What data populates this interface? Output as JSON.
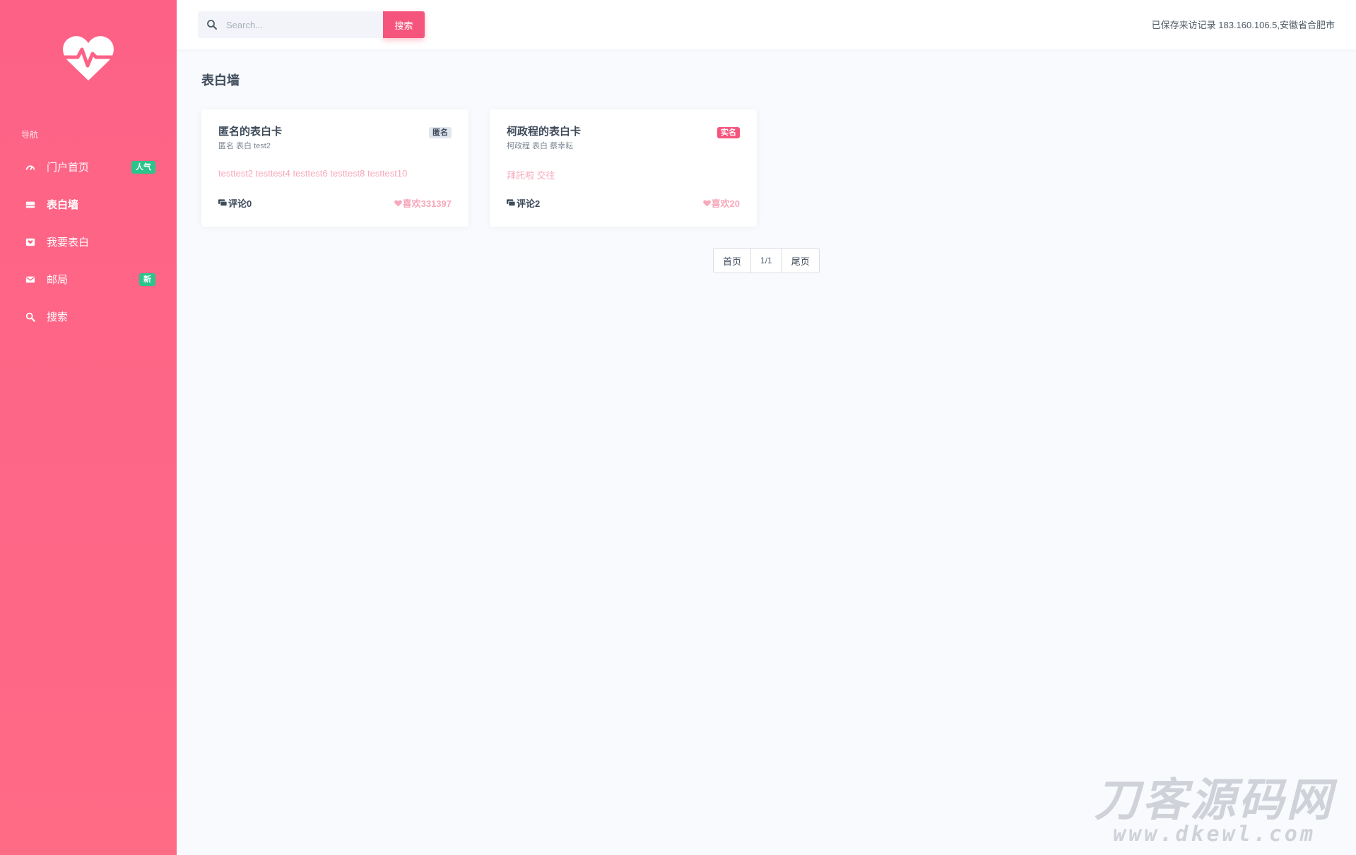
{
  "sidebar": {
    "nav_caption": "导航",
    "items": [
      {
        "label": "门户首页",
        "icon": "dashboard-icon",
        "badge": "人气"
      },
      {
        "label": "表白墙",
        "icon": "wall-icon",
        "active": true
      },
      {
        "label": "我要表白",
        "icon": "heart-box-icon"
      },
      {
        "label": "邮局",
        "icon": "mail-icon",
        "badge": "新"
      },
      {
        "label": "搜索",
        "icon": "search-icon"
      }
    ]
  },
  "topbar": {
    "search_placeholder": "Search...",
    "search_button": "搜索",
    "visit_record": "已保存来访记录 183.160.106.5,安徽省合肥市"
  },
  "main": {
    "title": "表白墙",
    "cards": [
      {
        "title": "匿名的表白卡",
        "subtitle": "匿名 表白 test2",
        "tag": "匿名",
        "body": "testtest2 testtest4 testtest6 testtest8 testtest10",
        "comments": "评论0",
        "likes": "喜欢331397"
      },
      {
        "title": "柯政程的表白卡",
        "subtitle": "柯政程 表白 蔡幸耘",
        "tag": "实名",
        "body": "拜託啦 交往",
        "comments": "评论2",
        "likes": "喜欢20"
      }
    ],
    "pagination": {
      "first": "首页",
      "current": "1/1",
      "last": "尾页"
    }
  },
  "watermark": {
    "title": "刀客源码网",
    "url": "www.dkewl.com"
  },
  "colors": {
    "sidebar": "#fd6286",
    "accent": "#f5557c",
    "badge_green": "#2bc48a"
  }
}
